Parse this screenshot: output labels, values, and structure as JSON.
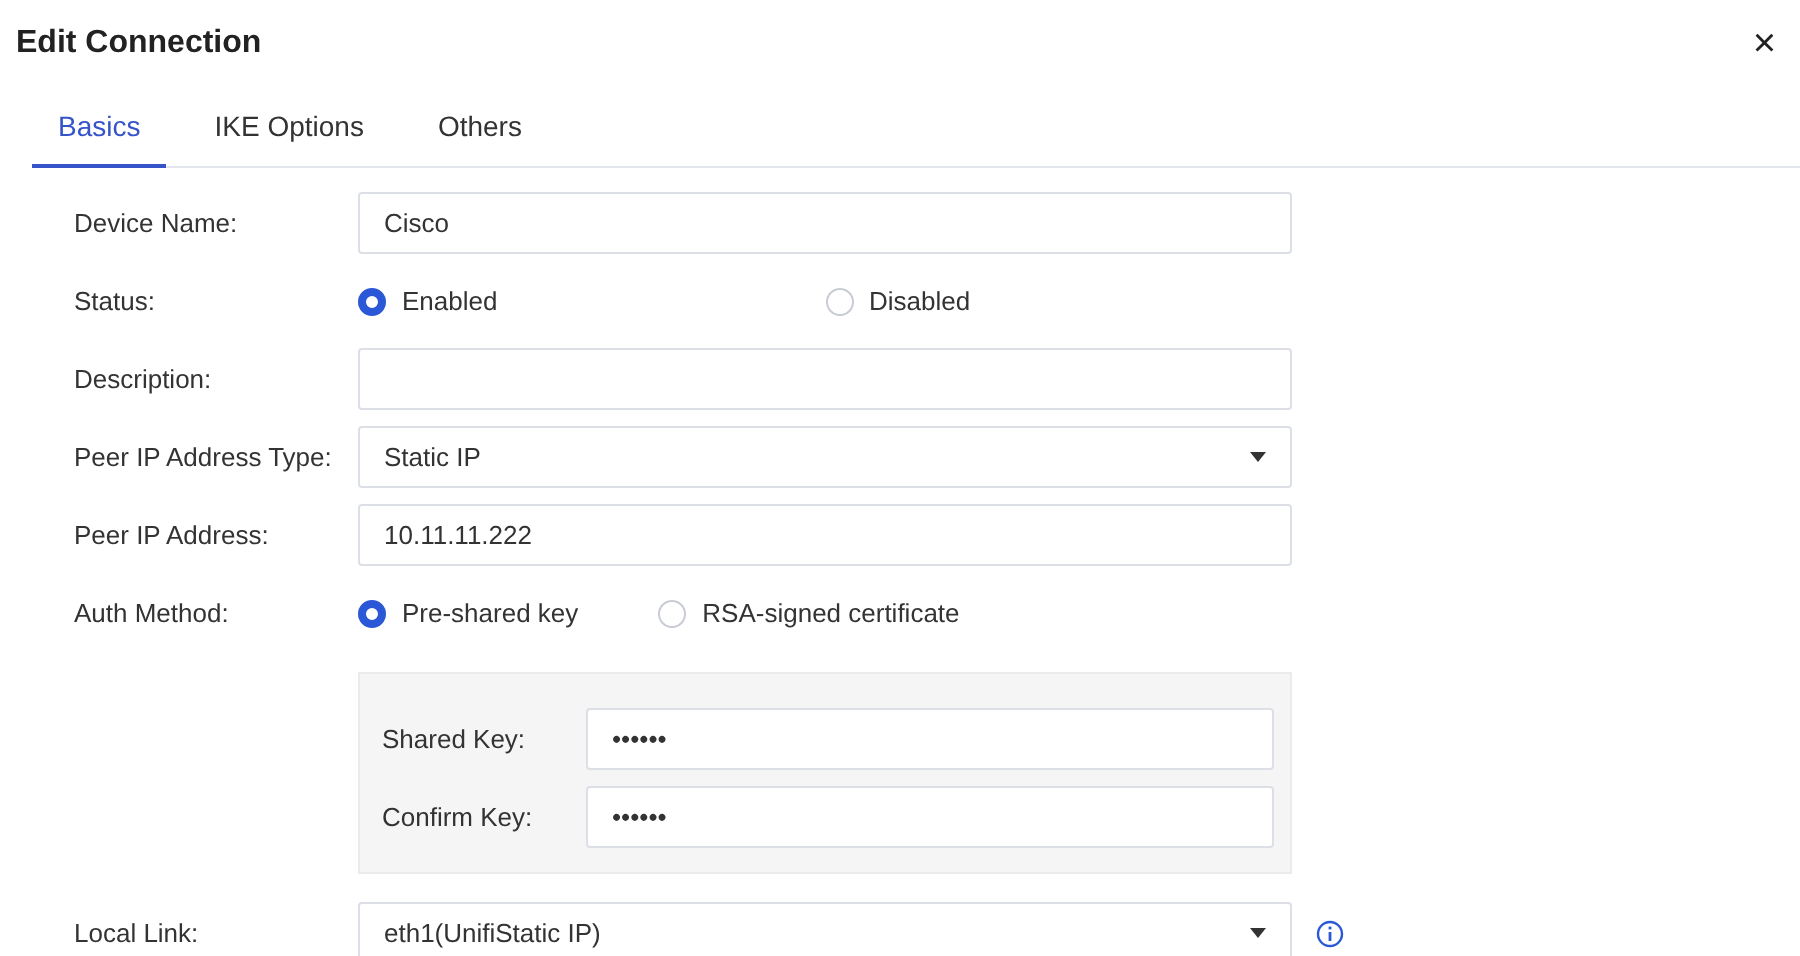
{
  "dialog": {
    "title": "Edit Connection",
    "close": "×"
  },
  "tabs": [
    {
      "label": "Basics",
      "selected": true
    },
    {
      "label": "IKE Options",
      "selected": false
    },
    {
      "label": "Others",
      "selected": false
    }
  ],
  "fields": [
    {
      "kind": "text",
      "label": "Device Name:",
      "value": "Cisco"
    },
    {
      "kind": "radio",
      "label": "Status:",
      "options": [
        {
          "label": "Enabled",
          "selected": true
        },
        {
          "label": "Disabled",
          "selected": false
        }
      ]
    },
    {
      "kind": "text",
      "label": "Description:"
    },
    {
      "kind": "select",
      "label": "Peer IP Address Type:",
      "value": "Static IP"
    },
    {
      "kind": "text",
      "label": "Peer IP Address:",
      "value": "10.11.11.222"
    },
    {
      "kind": "radio",
      "label": "Auth Method:",
      "options": [
        {
          "label": "Pre-shared key",
          "selected": true
        },
        {
          "label": "RSA-signed certificate",
          "selected": false
        }
      ]
    },
    {
      "kind": "group",
      "fields": [
        {
          "label": "Shared Key:",
          "value": "••••••"
        },
        {
          "label": "Confirm Key:",
          "value": "••••••"
        }
      ]
    },
    {
      "kind": "select",
      "label": "Local Link:",
      "value": "eth1(UnifiStatic IP)",
      "info": true
    }
  ]
}
